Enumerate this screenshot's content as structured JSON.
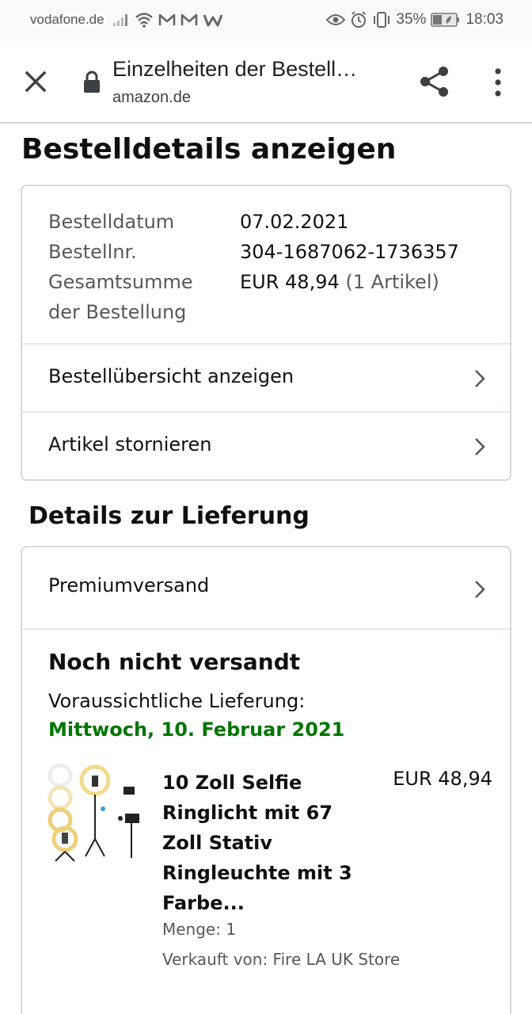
{
  "status_bar": {
    "carrier": "vodafone.de",
    "battery": "35%",
    "time": "18:03",
    "icons": [
      "signal-icon",
      "wifi-icon",
      "mail-icon",
      "mail-icon",
      "app-w-icon",
      "eye-icon",
      "alarm-icon",
      "vibrate-icon",
      "battery-icon"
    ]
  },
  "browser": {
    "title": "Einzelheiten der Bestell…",
    "domain": "amazon.de",
    "icons": [
      "close-icon",
      "lock-icon",
      "share-icon",
      "more-vert-icon"
    ]
  },
  "page": {
    "title": "Bestelldetails anzeigen"
  },
  "order_info": {
    "date_label": "Bestelldatum",
    "date_value": "07.02.2021",
    "number_label": "Bestellnr.",
    "number_value": "304-1687062-1736357",
    "total_label_line1": "Gesamtsumme",
    "total_label_line2": "der Bestellung",
    "total_value": "EUR 48,94",
    "total_items": "(1 Artikel)"
  },
  "order_links": [
    {
      "label": "Bestellübersicht anzeigen"
    },
    {
      "label": "Artikel stornieren"
    }
  ],
  "delivery": {
    "section_title": "Details zur Lieferung",
    "shipping_method": "Premiumversand",
    "status": "Noch nicht versandt",
    "expected_label": "Voraussichtliche Lieferung:",
    "expected_date": "Mittwoch, 10. Februar 2021",
    "date_color": "#007600"
  },
  "product": {
    "title": "10 Zoll Selfie Ringlicht mit 67 Zoll Stativ Ringleuchte mit 3 Farbe...",
    "price": "EUR 48,94",
    "quantity": "Menge: 1",
    "seller": "Verkauft von: Fire LA UK Store"
  }
}
